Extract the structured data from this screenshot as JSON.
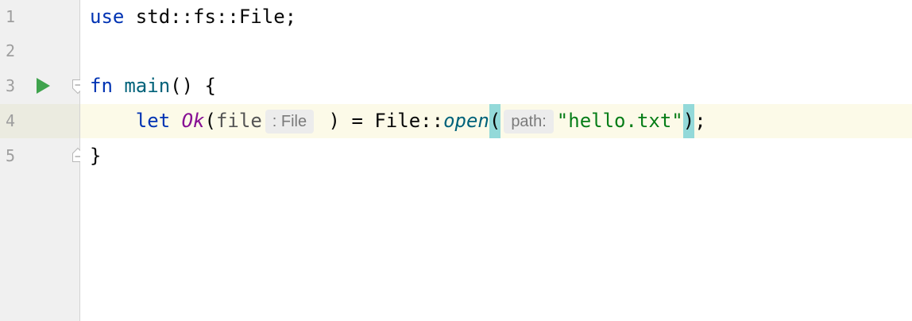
{
  "gutter": {
    "line_numbers": [
      "1",
      "2",
      "3",
      "4",
      "5"
    ],
    "run_icon": "run-icon",
    "fold_icons": [
      "fold-start-icon",
      "fold-end-icon"
    ]
  },
  "code": {
    "line1": {
      "kw": "use",
      "rest": " std::fs::File;"
    },
    "line3": {
      "kw": "fn",
      "sp": " ",
      "name": "main",
      "rest": "() {"
    },
    "line4": {
      "indent": "    ",
      "kw": "let",
      "sp1": " ",
      "enum": "Ok",
      "paren_open": "(",
      "var": "file",
      "type_hint": ": File",
      "after_var": " ) = File::",
      "method": "open",
      "paren2": "(",
      "param_hint": "path:",
      "string": "\"hello.txt\"",
      "paren2_close": ")",
      "semi": ";"
    },
    "line5": {
      "rest": "}"
    }
  },
  "colors": {
    "keyword": "#0033b3",
    "function": "#00627a",
    "enum_variant": "#871094",
    "string": "#067d17",
    "brace_match": "#93d9d9",
    "current_line": "#fcfae8",
    "gutter_bg": "#f0f0f0",
    "run_icon": "#3fa34d"
  }
}
